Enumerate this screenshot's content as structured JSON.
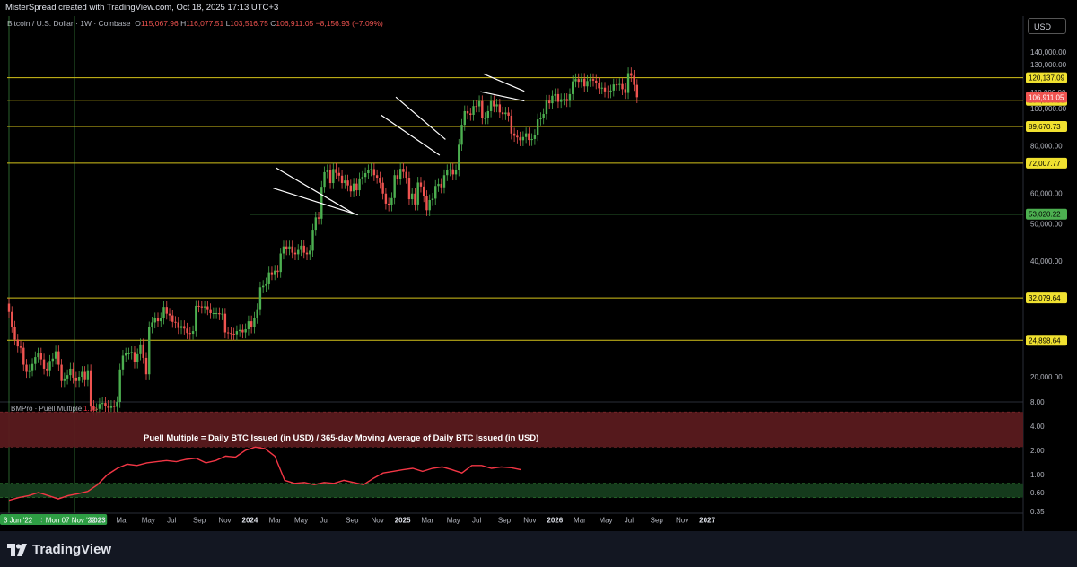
{
  "header": {
    "attribution": "MisterSpread created with TradingView.com, Oct 18, 2025 17:13 UTC+3"
  },
  "symbol": {
    "name": "Bitcoin / U.S. Dollar · 1W · Coinbase",
    "o_label": "O",
    "o": "115,067.96",
    "h_label": "H",
    "h": "116,077.51",
    "l_label": "L",
    "l": "103,516.75",
    "c_label": "C",
    "c": "106,911.05",
    "change": "−8,156.93 (−7.09%)"
  },
  "currency_button": "USD",
  "indicator": {
    "name": "BMPro · Puell Multiple",
    "value": "1.15",
    "annotation": "Puell Multiple = Daily BTC Issued (in USD) / 365-day Moving Average of Daily BTC Issued (in USD)"
  },
  "colors": {
    "background": "#000000",
    "up": "#26a69a",
    "up_bright": "#4caf50",
    "down": "#ef5350",
    "level_line": "#d4c21a",
    "support_line": "#4caf50",
    "trend_line": "#ffffff",
    "puell_line": "#f23645",
    "red_band": "#5a1a1d",
    "green_band": "#163d1e"
  },
  "footer": {
    "logo_text": "TradingView",
    "logo_icon": "tradingview-logo-icon"
  },
  "chart_data": [
    {
      "type": "candlestick",
      "title": "Bitcoin / U.S. Dollar · 1W · Coinbase",
      "scale": "log",
      "y_ticks": [
        "140,000.00",
        "130,000.00",
        "110,000.00",
        "100,000.00",
        "80,000.00",
        "60,000.00",
        "50,000.00",
        "40,000.00",
        "20,000.00"
      ],
      "x_ticks": [
        "3 Jun '22",
        "Sep",
        "Mon 07 Nov '22",
        "2023",
        "Mar",
        "May",
        "Jul",
        "Sep",
        "Nov",
        "2024",
        "Mar",
        "May",
        "Jul",
        "Sep",
        "Nov",
        "2025",
        "Mar",
        "May",
        "Jul",
        "Sep",
        "Nov",
        "2026",
        "Mar",
        "May",
        "Jul",
        "Sep",
        "Nov",
        "2027"
      ],
      "x_ticks_highlighted": [
        "3 Jun '22",
        "Mon 07 Nov '22"
      ],
      "horizontal_levels": [
        {
          "value": 120137.09,
          "label": "120,137.09",
          "style": "yellow"
        },
        {
          "value": 104987.35,
          "label": "104,987.35",
          "style": "yellow"
        },
        {
          "value": 89670.73,
          "label": "89,670.73",
          "style": "yellow"
        },
        {
          "value": 72007.77,
          "label": "72,007.77",
          "style": "yellow"
        },
        {
          "value": 53020.22,
          "label": "53,020.22",
          "style": "green"
        },
        {
          "value": 32079.64,
          "label": "32,079.64",
          "style": "yellow"
        },
        {
          "value": 24898.64,
          "label": "24,898.64",
          "style": "yellow"
        }
      ],
      "last_price": {
        "value": 106911.05,
        "label": "106,911.05"
      },
      "weekly_closes": [
        29500,
        27000,
        25000,
        24000,
        23800,
        21500,
        20600,
        20800,
        21600,
        22500,
        23000,
        22200,
        21000,
        20800,
        22000,
        22300,
        23300,
        21500,
        19500,
        19800,
        20200,
        21000,
        19900,
        19500,
        20000,
        20600,
        19600,
        20800,
        16800,
        16400,
        16500,
        17000,
        17100,
        16800,
        16600,
        16800,
        16700,
        17200,
        20900,
        22700,
        23000,
        23000,
        23200,
        21800,
        22900,
        24300,
        22400,
        20300,
        26900,
        27700,
        28400,
        27900,
        28400,
        30400,
        29200,
        28900,
        27800,
        27700,
        26800,
        27100,
        26700,
        26000,
        25900,
        26300,
        30600,
        30500,
        30300,
        30500,
        30000,
        29300,
        29300,
        29300,
        29100,
        29200,
        26100,
        26000,
        25900,
        25800,
        26300,
        26500,
        26100,
        26600,
        27900,
        26900,
        28500,
        30000,
        34200,
        34500,
        35000,
        37400,
        37000,
        37800,
        37500,
        41900,
        43700,
        43000,
        43700,
        42100,
        41700,
        42800,
        43900,
        42100,
        41700,
        42600,
        48300,
        52000,
        51600,
        62500,
        68200,
        69000,
        63900,
        69500,
        67900,
        66800,
        63900,
        64900,
        63000,
        60800,
        63700,
        61200,
        65700,
        66300,
        67800,
        69000,
        69500,
        67000,
        66000,
        64000,
        60000,
        56500,
        55900,
        58400,
        67000,
        65600,
        69600,
        68300,
        66000,
        58000,
        60000,
        56200,
        64100,
        62600,
        59100,
        54300,
        57700,
        58200,
        62800,
        63600,
        62300,
        67000,
        69000,
        69400,
        67300,
        69000,
        80400,
        90600,
        98300,
        97000,
        96200,
        101400,
        101200,
        104400,
        94300,
        94300,
        98300,
        104400,
        101200,
        102400,
        97600,
        96600,
        97500,
        95700,
        86000,
        84800,
        84000,
        82600,
        84200,
        86100,
        82700,
        83200,
        85200,
        93600,
        94300,
        96700,
        104700,
        103100,
        107800,
        108900,
        104000,
        105600,
        105700,
        104500,
        108900,
        117600,
        119200,
        117300,
        119400,
        114100,
        117800,
        119200,
        118100,
        116300,
        112800,
        113200,
        110700,
        110200,
        111300,
        115400,
        115300,
        115700,
        112200,
        109700,
        123500,
        121600,
        115100,
        106911
      ],
      "trendlines": [
        {
          "from": [
            "2024-03-04",
            70000
          ],
          "to": [
            "2024-09-09",
            53000
          ],
          "kind": "channel-upper"
        },
        {
          "from": [
            "2024-02-26",
            62000
          ],
          "to": [
            "2024-09-16",
            52800
          ],
          "kind": "channel-lower"
        },
        {
          "from": [
            "2024-11-11",
            96000
          ],
          "to": [
            "2025-03-31",
            75500
          ],
          "kind": "channel-lower"
        },
        {
          "from": [
            "2024-12-16",
            107000
          ],
          "to": [
            "2025-04-14",
            83000
          ],
          "kind": "channel-upper"
        },
        {
          "from": [
            "2025-07-14",
            123000
          ],
          "to": [
            "2025-10-20",
            110800
          ],
          "kind": "channel-upper"
        },
        {
          "from": [
            "2025-07-07",
            110500
          ],
          "to": [
            "2025-10-20",
            104500
          ],
          "kind": "channel-lower"
        }
      ]
    },
    {
      "type": "line",
      "title": "BMPro · Puell Multiple",
      "scale": "log",
      "y_ticks": [
        "8.00",
        "4.00",
        "2.00",
        "1.00",
        "0.60",
        "0.35"
      ],
      "bands": [
        {
          "from": 2.2,
          "to": 6.0,
          "color": "red"
        },
        {
          "from": 0.52,
          "to": 0.78,
          "color": "green"
        }
      ],
      "current_value": 1.15,
      "monthly_values": [
        0.48,
        0.52,
        0.55,
        0.6,
        0.55,
        0.5,
        0.55,
        0.58,
        0.62,
        0.75,
        1.0,
        1.2,
        1.35,
        1.3,
        1.4,
        1.45,
        1.5,
        1.45,
        1.55,
        1.6,
        1.4,
        1.5,
        1.7,
        1.65,
        2.0,
        2.2,
        2.1,
        1.7,
        0.85,
        0.78,
        0.8,
        0.75,
        0.8,
        0.78,
        0.85,
        0.8,
        0.75,
        0.9,
        1.05,
        1.1,
        1.15,
        1.2,
        1.1,
        1.2,
        1.25,
        1.15,
        1.05,
        1.3,
        1.3,
        1.2,
        1.25,
        1.22,
        1.15
      ]
    }
  ]
}
